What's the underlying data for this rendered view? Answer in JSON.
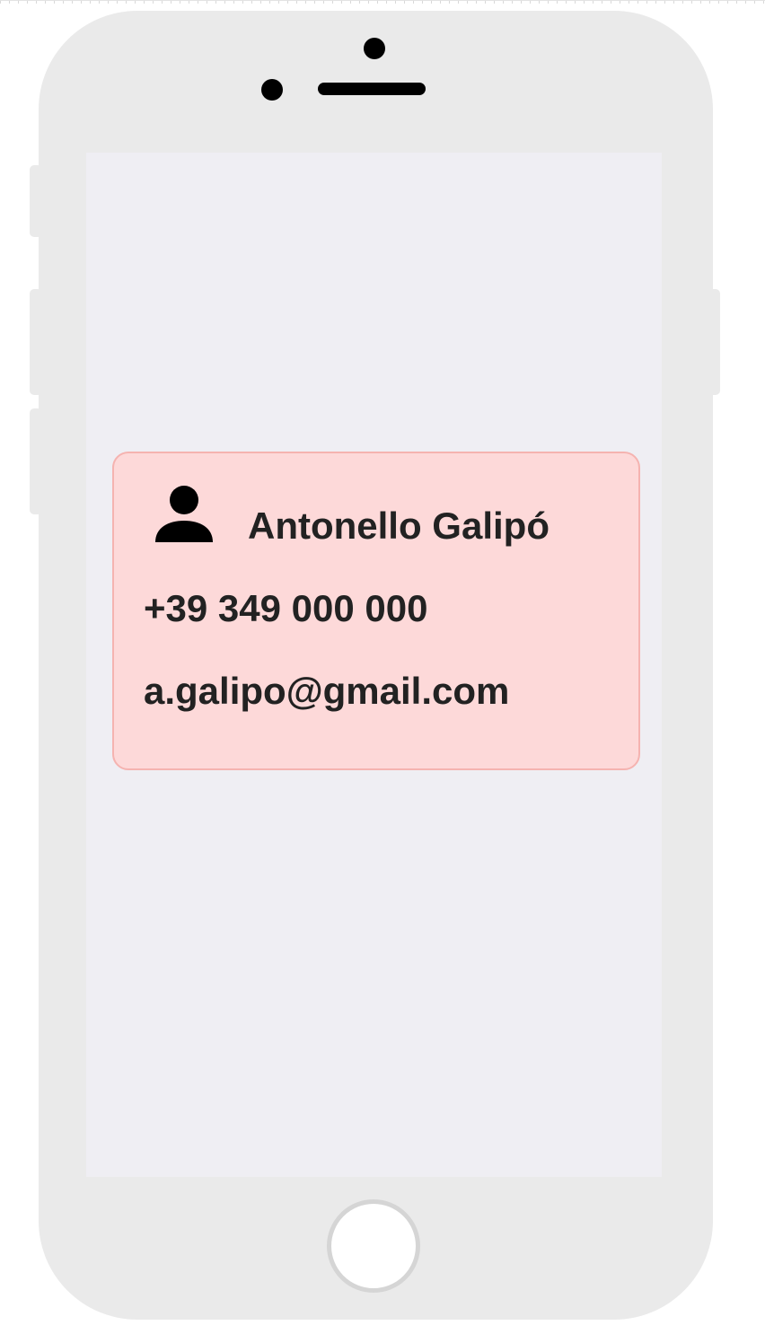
{
  "contact": {
    "name": "Antonello Galipó",
    "phone": "+39 349 000 000",
    "email": "a.galipo@gmail.com",
    "icon": "person-icon"
  },
  "colors": {
    "phone_body": "#eaeaea",
    "screen": "#efeef3",
    "card_background": "#fdd9d9",
    "card_border": "#f5b3b0",
    "text": "#222222"
  },
  "hardware": {
    "home_button_icon": "home-button",
    "camera_icon": "front-camera-icon",
    "speaker_icon": "earpiece-speaker-icon"
  }
}
